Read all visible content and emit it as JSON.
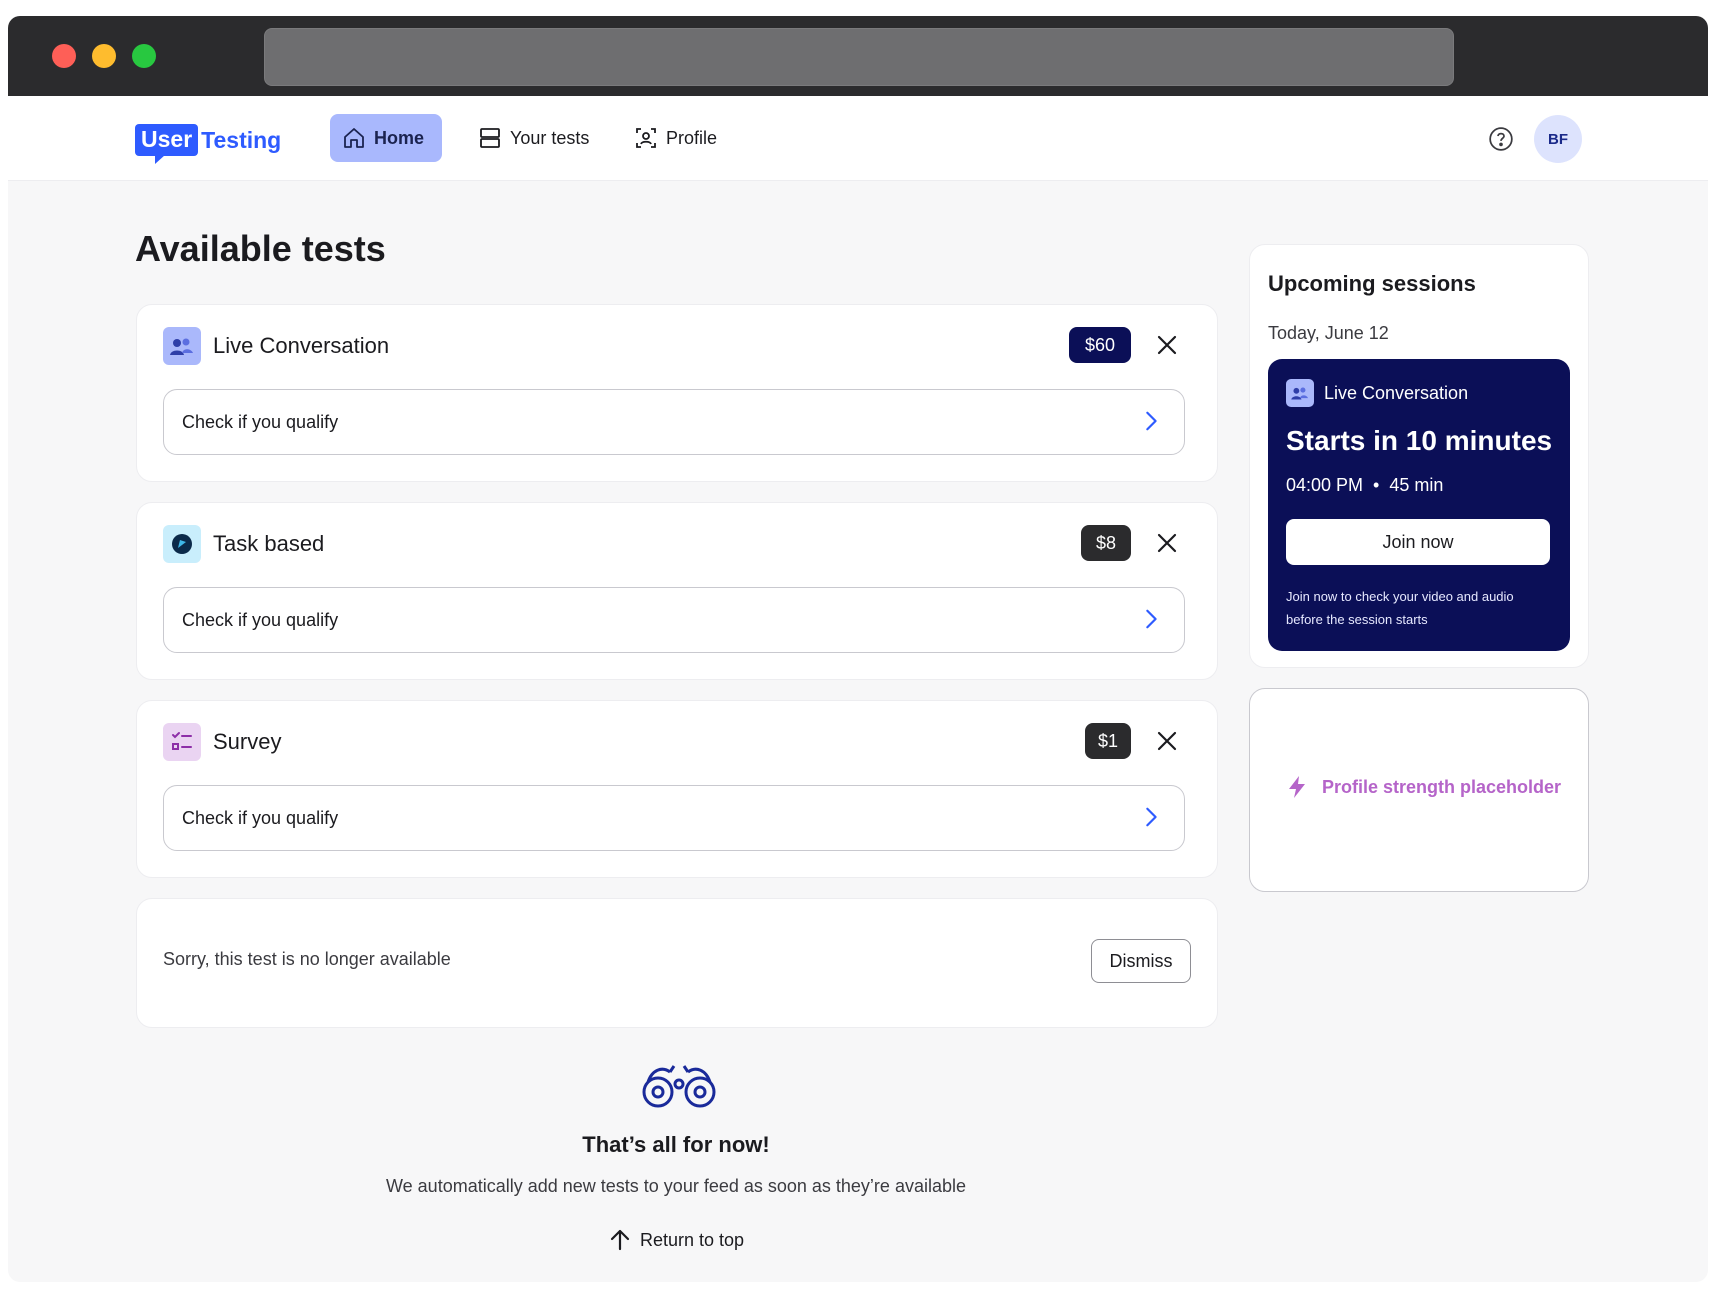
{
  "brand": {
    "logo_part1": "User",
    "logo_part2": "Testing"
  },
  "nav": {
    "items": [
      {
        "label": "Home",
        "icon": "home-icon",
        "active": true
      },
      {
        "label": "Your tests",
        "icon": "tests-icon",
        "active": false
      },
      {
        "label": "Profile",
        "icon": "profile-icon",
        "active": false
      }
    ],
    "avatar_initials": "BF",
    "help_icon": "help-icon"
  },
  "main": {
    "title": "Available tests",
    "tests": [
      {
        "type": "Live Conversation",
        "price": "$60",
        "qualify_label": "Check if you qualify",
        "icon": "live-conversation-icon",
        "price_color": "#0b0f57"
      },
      {
        "type": "Task based",
        "price": "$8",
        "qualify_label": "Check if you qualify",
        "icon": "task-based-icon",
        "price_color": "#2b2b2d"
      },
      {
        "type": "Survey",
        "price": "$1",
        "qualify_label": "Check if you qualify",
        "icon": "survey-icon",
        "price_color": "#2b2b2d"
      }
    ],
    "unavailable": {
      "text": "Sorry, this test is no longer available",
      "dismiss_label": "Dismiss"
    },
    "empty_state": {
      "title": "That’s all for now!",
      "subtitle": "We automatically add new tests to your feed as soon as they’re available",
      "return_label": "Return to top",
      "icon": "binoculars-icon"
    }
  },
  "sidebar": {
    "sessions": {
      "title": "Upcoming sessions",
      "date": "Today, June 12",
      "session": {
        "type": "Live Conversation",
        "starts": "Starts in 10 minutes",
        "time": "04:00 PM",
        "separator": "•",
        "duration": "45 min",
        "join_label": "Join now",
        "note": "Join now to check your video and audio before the session starts"
      }
    },
    "profile_strength": {
      "label": "Profile strength placeholder",
      "icon": "lightning-icon"
    }
  },
  "colors": {
    "brand_blue": "#2e5bff",
    "nav_active": "#a9b8fd",
    "session_bg": "#0b0f57",
    "strength_purple": "#b564c9"
  }
}
